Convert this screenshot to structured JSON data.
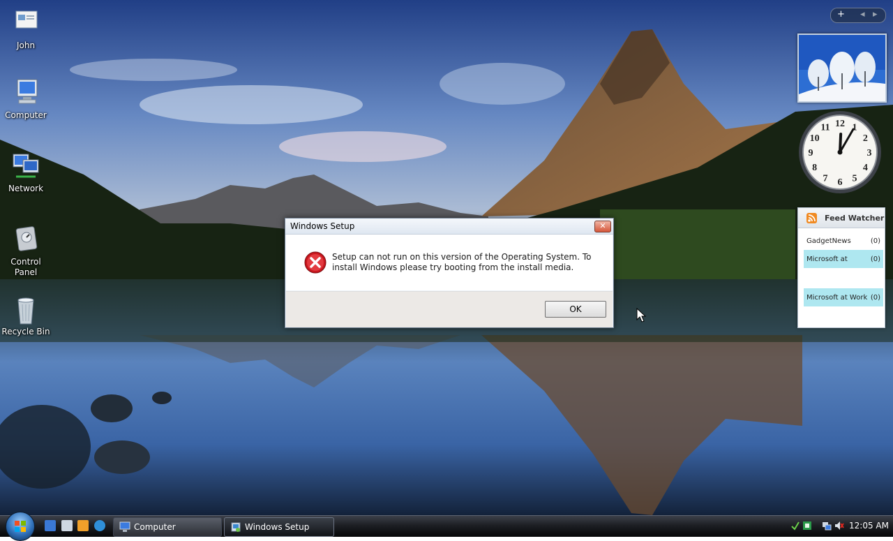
{
  "desktop": {
    "icons": [
      {
        "label": "John",
        "icon": "user-folder-icon"
      },
      {
        "label": "Computer",
        "icon": "computer-icon"
      },
      {
        "label": "Network",
        "icon": "network-icon"
      },
      {
        "label": "Control Panel",
        "icon": "control-panel-icon"
      },
      {
        "label": "Recycle Bin",
        "icon": "recycle-bin-icon"
      }
    ]
  },
  "dialog": {
    "title": "Windows Setup",
    "message": "Setup can not run on this version of the Operating System. To install Windows please try booting from the install media.",
    "ok_label": "OK",
    "close_glyph": "✕",
    "icon": "error-icon"
  },
  "sidebar": {
    "controls": {
      "add": "+",
      "prev": "◂",
      "next": "▸"
    },
    "clock": {
      "numbers": [
        "12",
        "1",
        "2",
        "3",
        "4",
        "5",
        "6",
        "7",
        "8",
        "9",
        "10",
        "11"
      ],
      "time": "12:05"
    },
    "feed": {
      "title": "Feed Watcher",
      "items": [
        {
          "name": "GadgetNews",
          "count": "(0)",
          "highlight": false
        },
        {
          "name": "Microsoft at",
          "count": "(0)",
          "highlight": true
        },
        {
          "name": "Microsoft at Work",
          "count": "(0)",
          "highlight": true
        }
      ]
    }
  },
  "taskbar": {
    "buttons": [
      {
        "label": "Computer",
        "icon": "computer-icon",
        "active": false
      },
      {
        "label": "Windows Setup",
        "icon": "setup-icon",
        "active": true
      }
    ],
    "quick_launch": [
      "ie-icon",
      "switch-windows-icon",
      "media-player-icon",
      "internet-explorer-icon"
    ],
    "tray_time": "12:05 AM"
  }
}
